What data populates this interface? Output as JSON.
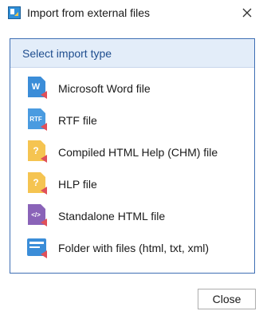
{
  "dialog": {
    "title": "Import from external files",
    "close_icon": "close-icon"
  },
  "panel": {
    "heading": "Select import type",
    "items": [
      {
        "label": "Microsoft Word file",
        "icon": "word-file-icon",
        "badge": "W",
        "color": "#3b8dd8"
      },
      {
        "label": "RTF file",
        "icon": "rtf-file-icon",
        "badge": "RTF",
        "color": "#4a9be0"
      },
      {
        "label": "Compiled HTML Help (CHM) file",
        "icon": "chm-file-icon",
        "badge": "?",
        "color": "#f5c451"
      },
      {
        "label": "HLP file",
        "icon": "hlp-file-icon",
        "badge": "?",
        "color": "#f5c451"
      },
      {
        "label": "Standalone HTML file",
        "icon": "html-file-icon",
        "badge": "</>",
        "color": "#8a63b8"
      },
      {
        "label": "Folder with files (html, txt, xml)",
        "icon": "folder-files-icon",
        "badge": "",
        "color": "#3b8dd8"
      }
    ]
  },
  "buttons": {
    "close_label": "Close"
  }
}
